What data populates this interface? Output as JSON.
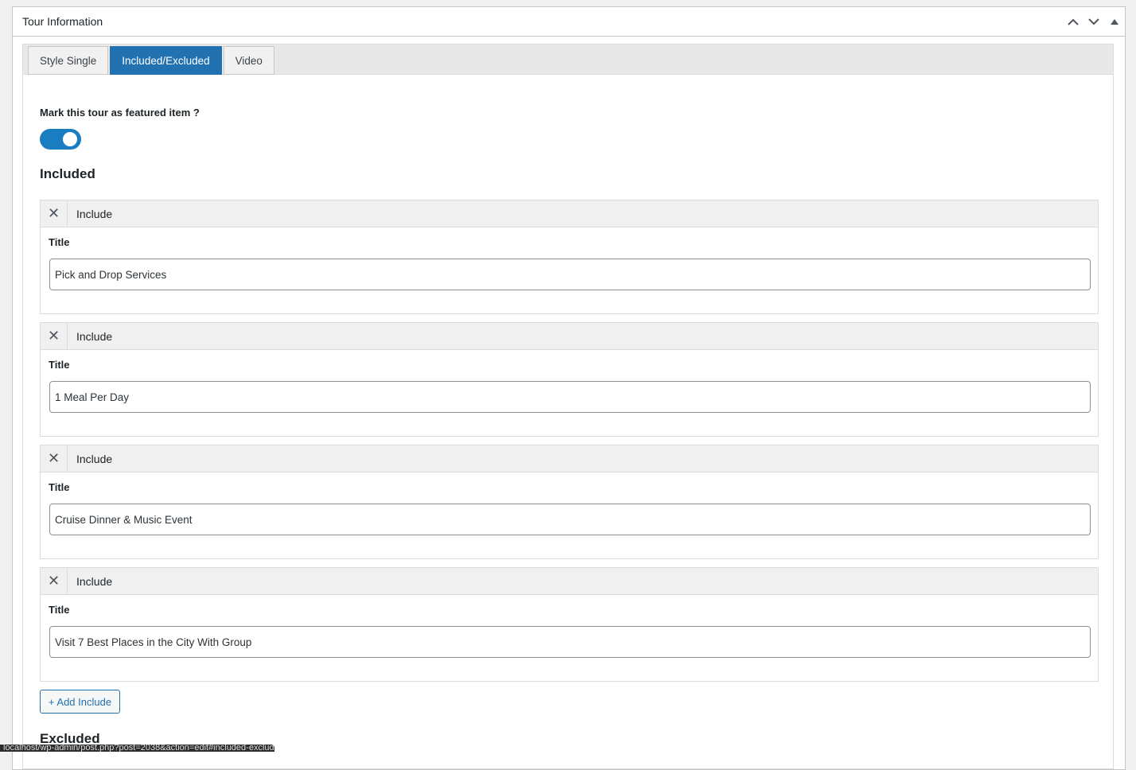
{
  "metabox": {
    "title": "Tour Information"
  },
  "tabs": [
    {
      "label": "Style Single",
      "active": false
    },
    {
      "label": "Included/Excluded",
      "active": true
    },
    {
      "label": "Video",
      "active": false
    }
  ],
  "featured": {
    "label": "Mark this tour as featured item ?",
    "enabled": true,
    "accent_color": "#1a7cc1"
  },
  "included": {
    "heading": "Included",
    "items": [
      {
        "head_label": "Include",
        "remove_glyph": "✕",
        "title_label": "Title",
        "value": "Pick and Drop Services"
      },
      {
        "head_label": "Include",
        "remove_glyph": "✕",
        "title_label": "Title",
        "value": "1 Meal Per Day"
      },
      {
        "head_label": "Include",
        "remove_glyph": "✕",
        "title_label": "Title",
        "value": "Cruise Dinner & Music Event"
      },
      {
        "head_label": "Include",
        "remove_glyph": "✕",
        "title_label": "Title",
        "value": "Visit 7 Best Places in the City With Group"
      }
    ],
    "add_label": "+ Add Include"
  },
  "excluded": {
    "heading": "Excluded"
  },
  "status_url": "localhost/wp-admin/post.php?post=2038&action=edit#included-excluded"
}
